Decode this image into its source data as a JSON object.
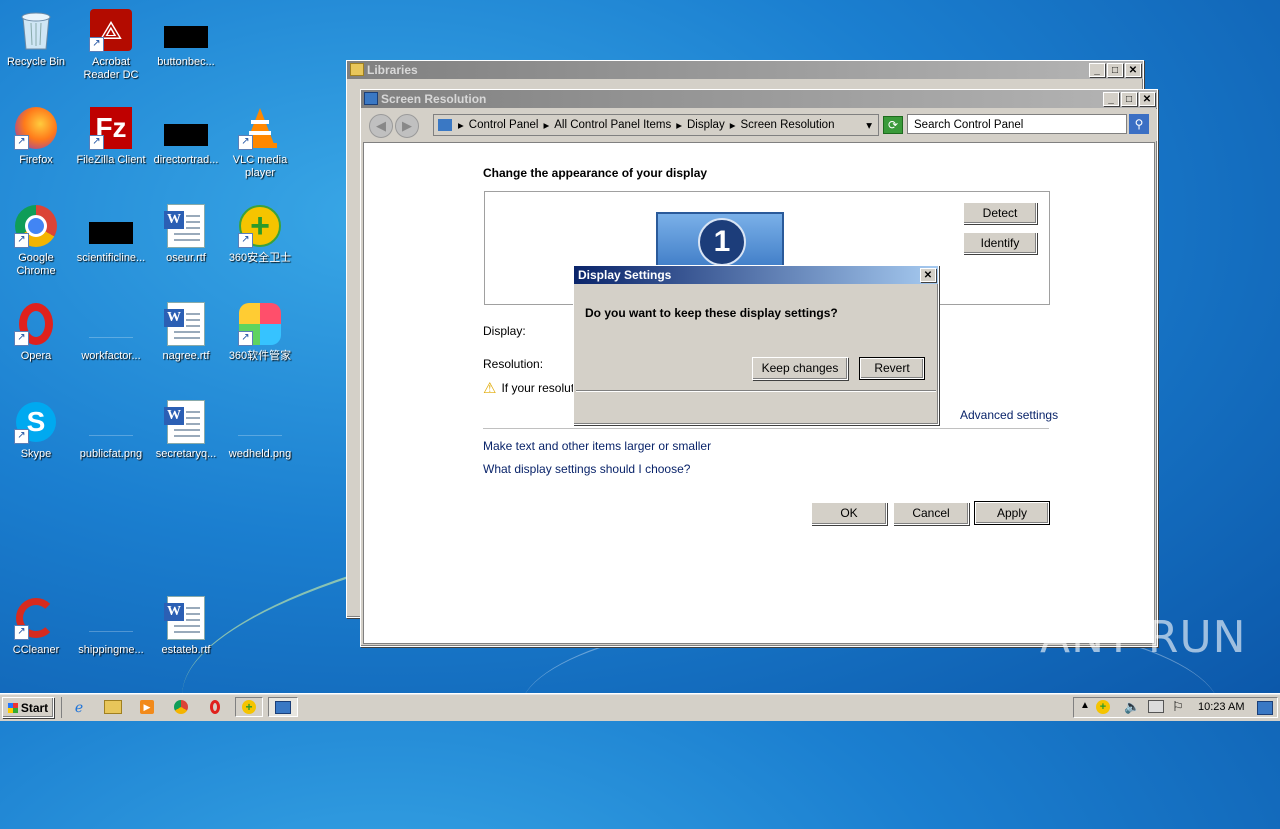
{
  "desktop": {
    "icons": [
      {
        "label": "Recycle Bin"
      },
      {
        "label": "Acrobat Reader DC"
      },
      {
        "label": "buttonbec..."
      },
      {
        "label": "Firefox"
      },
      {
        "label": "FileZilla Client"
      },
      {
        "label": "directortrad..."
      },
      {
        "label": "VLC media player"
      },
      {
        "label": "Google Chrome"
      },
      {
        "label": "scientificline..."
      },
      {
        "label": "oseur.rtf"
      },
      {
        "label": "360安全卫士"
      },
      {
        "label": "Opera"
      },
      {
        "label": "workfactor..."
      },
      {
        "label": "nagree.rtf"
      },
      {
        "label": "360软件管家"
      },
      {
        "label": "Skype"
      },
      {
        "label": "publicfat.png"
      },
      {
        "label": "secretaryq..."
      },
      {
        "label": "wedheld.png"
      },
      {
        "label": "CCleaner"
      },
      {
        "label": "shippingme..."
      },
      {
        "label": "estateb.rtf"
      }
    ]
  },
  "libraries_window": {
    "title": "Libraries"
  },
  "screen_resolution_window": {
    "title": "Screen Resolution",
    "breadcrumb": [
      "Control Panel",
      "All Control Panel Items",
      "Display",
      "Screen Resolution"
    ],
    "search_placeholder": "Search Control Panel",
    "heading": "Change the appearance of your display",
    "monitor_number": "1",
    "detect_label": "Detect",
    "identify_label": "Identify",
    "display_label": "Display:",
    "resolution_label": "Resolution:",
    "warning_text": "If your resolut",
    "advanced_link": "Advanced settings",
    "link_text_size": "Make text and other items larger or smaller",
    "link_help": "What display settings should I choose?",
    "ok_label": "OK",
    "cancel_label": "Cancel",
    "apply_label": "Apply"
  },
  "dialog": {
    "title": "Display Settings",
    "question": "Do you want to keep these display settings?",
    "keep_label": "Keep changes",
    "revert_label": "Revert"
  },
  "taskbar": {
    "start_label": "Start",
    "clock": "10:23 AM"
  },
  "watermark": "ANY RUN"
}
